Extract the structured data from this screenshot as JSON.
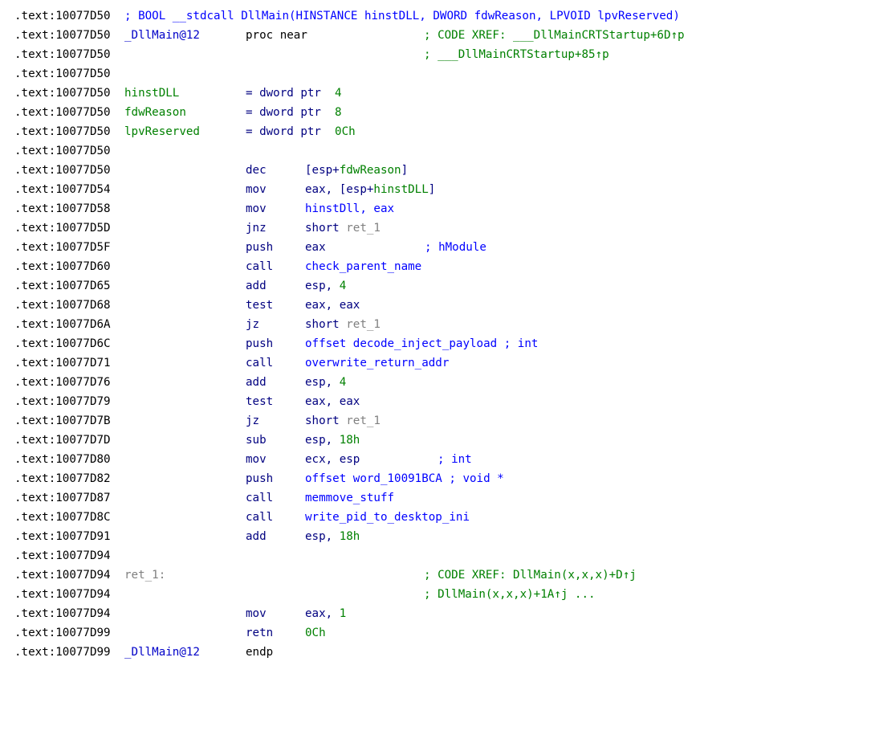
{
  "header_comment": "; BOOL __stdcall DllMain(HINSTANCE hinstDLL, DWORD fdwReason, LPVOID lpvReserved)",
  "proc": {
    "label": "_DllMain@12",
    "keyword": "proc near",
    "xref1": "; CODE XREF: ___DllMainCRTStartup+6D↑p",
    "xref2": "; ___DllMainCRTStartup+85↑p"
  },
  "vars": [
    {
      "name": "hinstDLL",
      "decl": "= dword ptr ",
      "offset": "4"
    },
    {
      "name": "fdwReason",
      "decl": "= dword ptr ",
      "offset": "8"
    },
    {
      "name": "lpvReserved",
      "decl": "= dword ptr ",
      "offset": "0Ch"
    }
  ],
  "addresses": {
    "a50": ".text:10077D50",
    "a54": ".text:10077D54",
    "a58": ".text:10077D58",
    "a5D": ".text:10077D5D",
    "a5F": ".text:10077D5F",
    "a60": ".text:10077D60",
    "a65": ".text:10077D65",
    "a68": ".text:10077D68",
    "a6A": ".text:10077D6A",
    "a6C": ".text:10077D6C",
    "a71": ".text:10077D71",
    "a76": ".text:10077D76",
    "a79": ".text:10077D79",
    "a7B": ".text:10077D7B",
    "a7D": ".text:10077D7D",
    "a80": ".text:10077D80",
    "a82": ".text:10077D82",
    "a87": ".text:10077D87",
    "a8C": ".text:10077D8C",
    "a91": ".text:10077D91",
    "a94": ".text:10077D94",
    "a99": ".text:10077D99"
  },
  "instructions": {
    "i1": {
      "mn": "dec",
      "op1": "[esp+",
      "op2": "fdwReason",
      "op3": "]"
    },
    "i2": {
      "mn": "mov",
      "op1": "eax, [esp+",
      "op2": "hinstDLL",
      "op3": "]"
    },
    "i3": {
      "mn": "mov",
      "op1": "hinstDll, eax"
    },
    "i4": {
      "mn": "jnz",
      "op1": "short ",
      "op2": "ret_1"
    },
    "i5": {
      "mn": "push",
      "op1": "eax",
      "cmt": "; hModule"
    },
    "i6": {
      "mn": "call",
      "op1": "check_parent_name"
    },
    "i7": {
      "mn": "add",
      "op1": "esp, ",
      "op2": "4"
    },
    "i8": {
      "mn": "test",
      "op1": "eax, eax"
    },
    "i9": {
      "mn": "jz",
      "op1": "short ",
      "op2": "ret_1"
    },
    "i10": {
      "mn": "push",
      "op1": "offset decode_inject_payload ; int"
    },
    "i11": {
      "mn": "call",
      "op1": "overwrite_return_addr"
    },
    "i12": {
      "mn": "add",
      "op1": "esp, ",
      "op2": "4"
    },
    "i13": {
      "mn": "test",
      "op1": "eax, eax"
    },
    "i14": {
      "mn": "jz",
      "op1": "short ",
      "op2": "ret_1"
    },
    "i15": {
      "mn": "sub",
      "op1": "esp, ",
      "op2": "18h"
    },
    "i16": {
      "mn": "mov",
      "op1": "ecx, esp",
      "cmt": "; int"
    },
    "i17": {
      "mn": "push",
      "op1": "offset word_10091BCA ; void *"
    },
    "i18": {
      "mn": "call",
      "op1": "memmove_stuff"
    },
    "i19": {
      "mn": "call",
      "op1": "write_pid_to_desktop_ini"
    },
    "i20": {
      "mn": "add",
      "op1": "esp, ",
      "op2": "18h"
    },
    "i21": {
      "mn": "mov",
      "op1": "eax, ",
      "op2": "1"
    },
    "i22": {
      "mn": "retn",
      "op1": "0Ch"
    }
  },
  "ret_label": "ret_1:",
  "ret_xref1": "; CODE XREF: DllMain(x,x,x)+D↑j",
  "ret_xref2": "; DllMain(x,x,x)+1A↑j ...",
  "endp": {
    "label": "_DllMain@12",
    "keyword": "endp"
  }
}
